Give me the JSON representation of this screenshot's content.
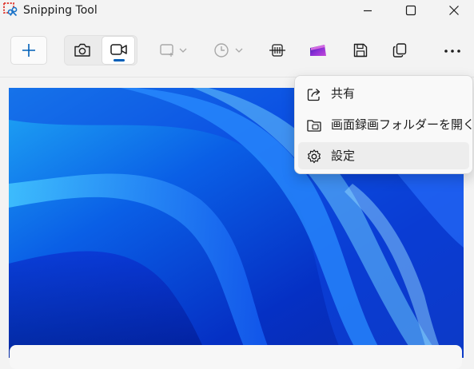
{
  "window": {
    "title": "Snipping Tool"
  },
  "toolbar": {
    "new_icon": "plus-icon",
    "modes": [
      {
        "icon": "camera-icon",
        "selected": false
      },
      {
        "icon": "video-camera-icon",
        "selected": true
      }
    ],
    "buttons": [
      "rectangle-mode-icon",
      "timer-icon",
      "text-actions-icon",
      "clipchamp-icon",
      "save-icon",
      "copy-icon",
      "more-icon"
    ]
  },
  "menu": {
    "items": [
      {
        "label": "共有",
        "icon": "share-icon"
      },
      {
        "label": "画面録画フォルダーを開く",
        "icon": "folder-icon"
      },
      {
        "label": "設定",
        "icon": "gear-icon"
      }
    ],
    "hovered_index": 2
  },
  "colors": {
    "accent": "#005fb8",
    "background": "#f3f3f3",
    "menu_background": "#f9f9f9"
  }
}
